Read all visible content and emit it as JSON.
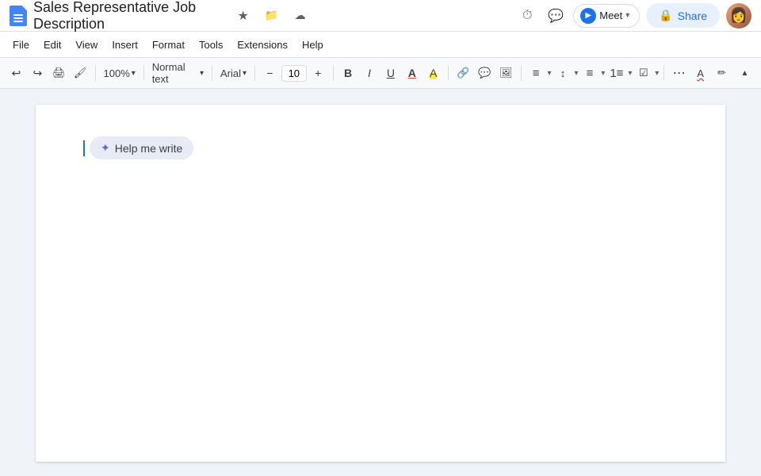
{
  "titleBar": {
    "docTitle": "Sales Representative Job Description",
    "starIcon": "★",
    "historyIcon": "⟲",
    "cloudIcon": "☁",
    "meetLabel": "Meet",
    "meetDropdownIcon": "▾",
    "shareIcon": "🔒",
    "shareLabel": "Share"
  },
  "menuBar": {
    "items": [
      "File",
      "Edit",
      "View",
      "Insert",
      "Format",
      "Tools",
      "Extensions",
      "Help"
    ]
  },
  "toolbar": {
    "undoLabel": "↩",
    "redoLabel": "↪",
    "printLabel": "🖨",
    "formatPaintLabel": "🖌",
    "zoomLevel": "100%",
    "zoomDropdown": "▾",
    "normalTextLabel": "Normal text",
    "normalTextDropdown": "▾",
    "fontLabel": "Arial",
    "fontDropdown": "▾",
    "fontSizeMinus": "−",
    "fontSize": "10",
    "fontSizePlus": "+",
    "boldLabel": "B",
    "italicLabel": "I",
    "underlineLabel": "U",
    "fontColorLabel": "A",
    "highlightLabel": "A",
    "linkLabel": "🔗",
    "imageLabel": "⬜",
    "commentLabel": "💬",
    "alignLabel": "≡",
    "lineSpacingLabel": "↕",
    "listLabel": "≡",
    "numberedListLabel": "1≡",
    "checklistLabel": "☑",
    "moreLabel": "⋯",
    "activitiesLabel": "📝",
    "chevronUp": "▲"
  },
  "document": {
    "helpMeWriteLabel": "Help me write",
    "penIconSymbol": "✦",
    "cursorVisible": true
  }
}
